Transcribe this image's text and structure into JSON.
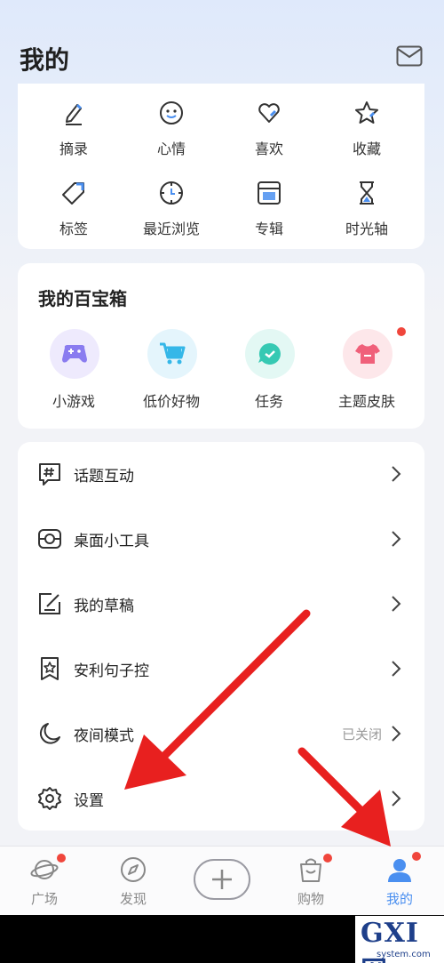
{
  "header": {
    "title": "我的",
    "mail_icon": "mail-icon"
  },
  "quick_actions": [
    {
      "label": "摘录",
      "icon": "pen-icon"
    },
    {
      "label": "心情",
      "icon": "smile-icon"
    },
    {
      "label": "喜欢",
      "icon": "heart-icon"
    },
    {
      "label": "收藏",
      "icon": "star-icon"
    },
    {
      "label": "标签",
      "icon": "tag-icon"
    },
    {
      "label": "最近浏览",
      "icon": "clock-icon"
    },
    {
      "label": "专辑",
      "icon": "album-icon"
    },
    {
      "label": "时光轴",
      "icon": "hourglass-icon"
    }
  ],
  "toolbox": {
    "title": "我的百宝箱",
    "items": [
      {
        "label": "小游戏",
        "icon": "gamepad-icon",
        "color": "#8a7cf0",
        "bg": "#eeeafd"
      },
      {
        "label": "低价好物",
        "icon": "cart-icon",
        "color": "#35b7e8",
        "bg": "#e4f5fc"
      },
      {
        "label": "任务",
        "icon": "chat-bubble-icon",
        "color": "#36c9b3",
        "bg": "#e3f8f4"
      },
      {
        "label": "主题皮肤",
        "icon": "tshirt-icon",
        "color": "#f0607a",
        "bg": "#fde7ea",
        "badge": true
      }
    ]
  },
  "menu": [
    {
      "label": "话题互动",
      "icon": "hashtag-icon",
      "value": ""
    },
    {
      "label": "桌面小工具",
      "icon": "widget-icon",
      "value": ""
    },
    {
      "label": "我的草稿",
      "icon": "draft-icon",
      "value": ""
    },
    {
      "label": "安利句子控",
      "icon": "bookmark-star-icon",
      "value": ""
    },
    {
      "label": "夜间模式",
      "icon": "moon-icon",
      "value": "已关闭"
    },
    {
      "label": "设置",
      "icon": "gear-icon",
      "value": ""
    }
  ],
  "tabbar": {
    "tabs": [
      {
        "label": "广场",
        "icon": "planet-icon",
        "badge": true,
        "active": false
      },
      {
        "label": "发现",
        "icon": "compass-icon",
        "badge": false,
        "active": false
      },
      {
        "label": "购物",
        "icon": "shopping-bag-icon",
        "badge": true,
        "active": false
      },
      {
        "label": "我的",
        "icon": "user-icon",
        "badge": true,
        "active": true
      }
    ],
    "publish_icon": "plus-icon"
  },
  "watermark": {
    "main": "GXI网",
    "sub": "system.com"
  },
  "colors": {
    "accent": "#4a8ff0",
    "badge": "#f0463c",
    "arrow": "#e8201f"
  }
}
